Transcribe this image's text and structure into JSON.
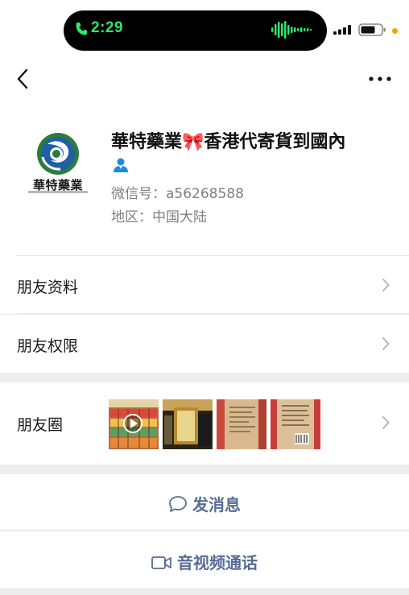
{
  "status_bar": {
    "time": "2:29"
  },
  "profile": {
    "avatar_text": "華特藥業",
    "nickname": "華特藥業🎀香港代寄貨到國內",
    "wechat_id": "微信号：a56268588",
    "region": "地区：中国大陆"
  },
  "menu": {
    "friend_info": "朋友资料",
    "friend_permissions": "朋友权限",
    "moments": "朋友圈"
  },
  "actions": {
    "send_message": "发消息",
    "video_call": "音视频通话"
  },
  "colors": {
    "accent": "#576b95",
    "status_green": "#2ee66b",
    "icon_blue": "#1e88e5",
    "background": "#ededed"
  }
}
